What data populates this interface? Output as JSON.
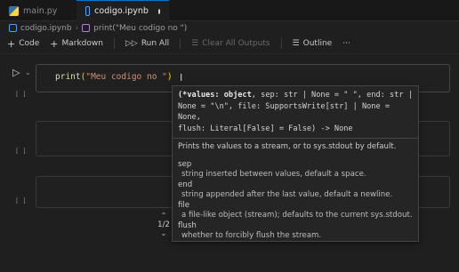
{
  "tabs": [
    {
      "label": "main.py",
      "icon": "python-file-icon",
      "active": false
    },
    {
      "label": "codigo.ipynb",
      "icon": "notebook-icon",
      "active": true,
      "dirty": true
    }
  ],
  "breadcrumb": {
    "file": "codigo.ipynb",
    "cell_symbol": "print(\"Meu codigo no \")"
  },
  "toolbar": {
    "code": "Code",
    "markdown": "Markdown",
    "run_all": "Run All",
    "clear_all": "Clear All Outputs",
    "outline": "Outline",
    "more": "···"
  },
  "cells": [
    {
      "exec": "[ ]",
      "code": {
        "fn": "print",
        "open": "(",
        "str": "\"Meu codigo no \"",
        "close": ")"
      }
    },
    {
      "exec": "[ ]"
    },
    {
      "exec": "[ ]"
    }
  ],
  "popup": {
    "sig_line1_active": "(*values: object",
    "sig_line1_rest": ", sep: str | None = \" \", end: str |",
    "sig_line2": "None = \"\\n\", file: SupportsWrite[str] | None = None,",
    "sig_line3": "flush: Literal[False] = False) -> None",
    "summary": "Prints the values to a stream, or to sys.stdout by default.",
    "params": [
      {
        "name": "sep",
        "desc": "string inserted between values, default a space."
      },
      {
        "name": "end",
        "desc": "string appended after the last value, default a newline."
      },
      {
        "name": "file",
        "desc": "a file-like object (stream); defaults to the current sys.stdout."
      },
      {
        "name": "flush",
        "desc": "whether to forcibly flush the stream."
      }
    ],
    "pager": "1/2"
  },
  "colors": {
    "background": "#1f1f1f",
    "accent": "#0078d4",
    "function": "#dcdcaa",
    "string": "#ce9178",
    "bracket": "#ffd700"
  }
}
